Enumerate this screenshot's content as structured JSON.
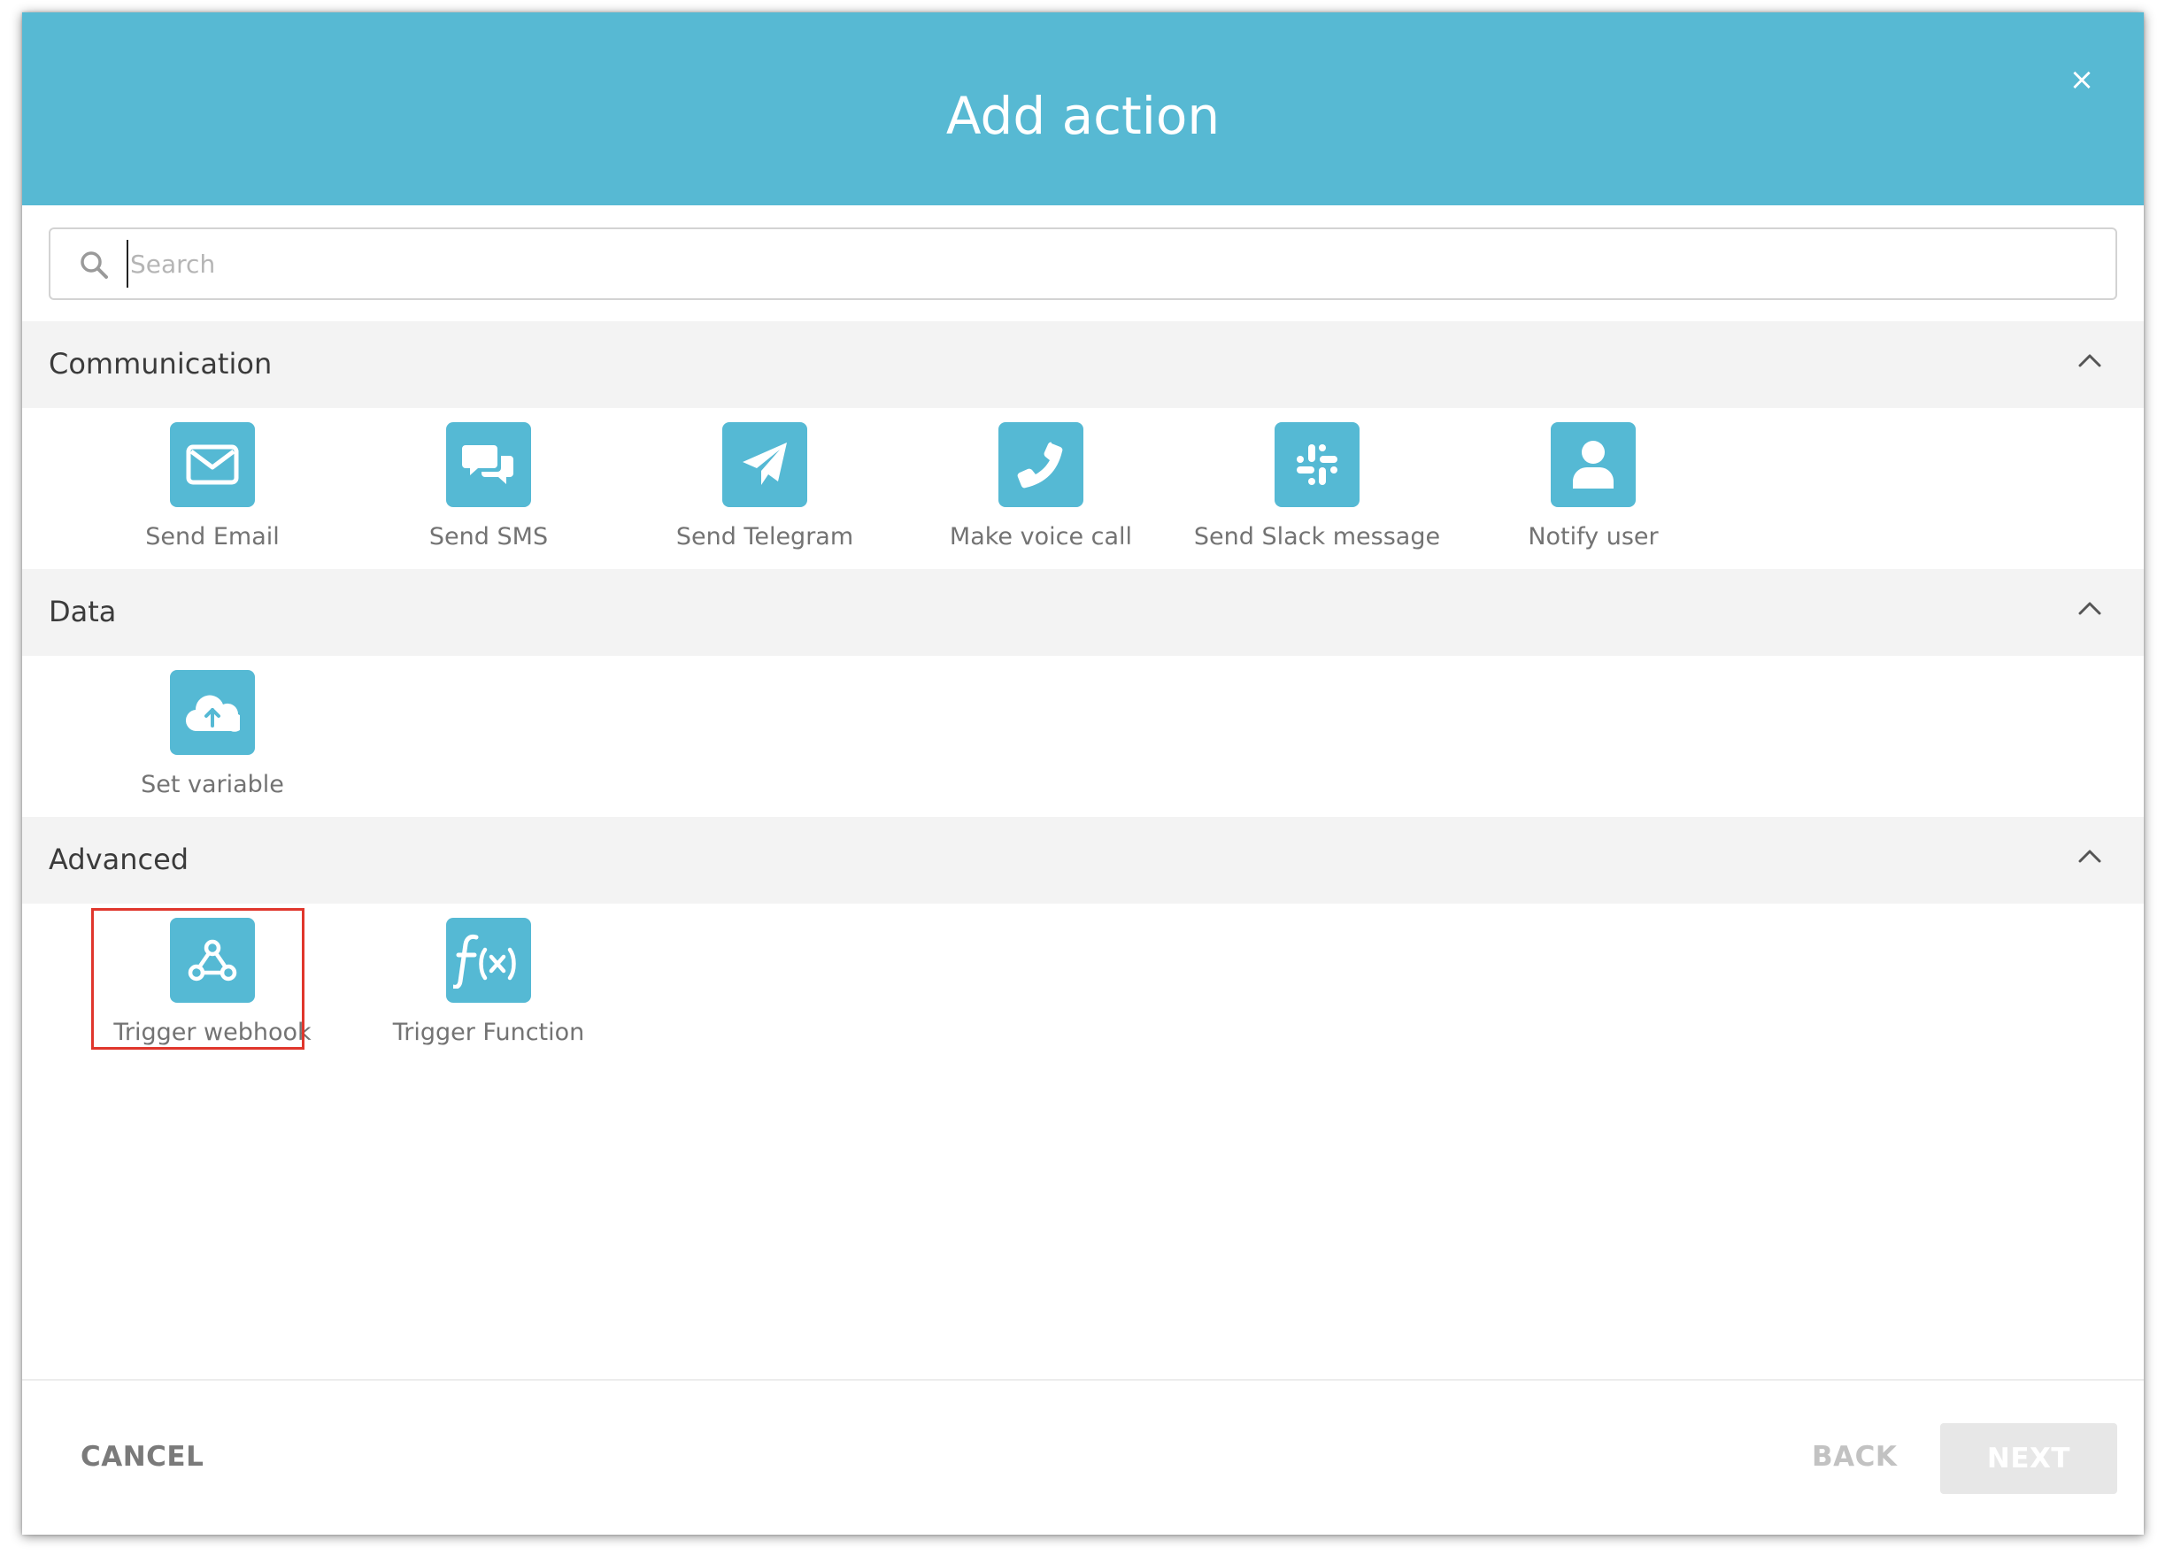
{
  "dialog": {
    "title": "Add action",
    "close_label": "×"
  },
  "search": {
    "placeholder": "Search",
    "value": ""
  },
  "sections": [
    {
      "title": "Communication",
      "items": [
        {
          "label": "Send Email",
          "icon": "envelope-icon"
        },
        {
          "label": "Send SMS",
          "icon": "chat-bubbles-icon"
        },
        {
          "label": "Send Telegram",
          "icon": "paper-plane-icon"
        },
        {
          "label": "Make voice call",
          "icon": "phone-icon"
        },
        {
          "label": "Send Slack message",
          "icon": "slack-icon"
        },
        {
          "label": "Notify user",
          "icon": "user-icon"
        }
      ]
    },
    {
      "title": "Data",
      "items": [
        {
          "label": "Set variable",
          "icon": "cloud-upload-icon"
        }
      ]
    },
    {
      "title": "Advanced",
      "items": [
        {
          "label": "Trigger webhook",
          "icon": "webhook-icon",
          "highlighted": true
        },
        {
          "label": "Trigger Function",
          "icon": "function-icon"
        }
      ]
    }
  ],
  "footer": {
    "cancel_label": "CANCEL",
    "back_label": "BACK",
    "next_label": "NEXT"
  },
  "colors": {
    "header": "#57b9d3",
    "icon_tile": "#55b9d4",
    "section_bg": "#f3f3f3",
    "highlight": "#e0362c"
  }
}
